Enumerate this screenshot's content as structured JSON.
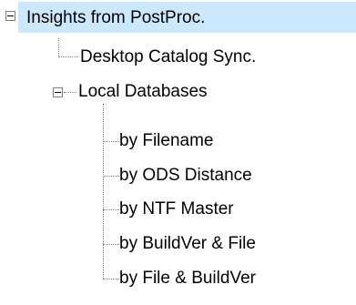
{
  "tree": {
    "root": {
      "label": "Insights from PostProc.",
      "expanded": true,
      "selected": true
    },
    "nodes": [
      {
        "label": "Desktop Catalog Sync."
      },
      {
        "label": "Local Databases",
        "expanded": true,
        "children": [
          {
            "label": "by Filename"
          },
          {
            "label": "by ODS Distance"
          },
          {
            "label": "by NTF Master"
          },
          {
            "label": "by BuildVer & File"
          },
          {
            "label": "by File & BuildVer"
          }
        ]
      }
    ]
  },
  "colors": {
    "selection_background": "#cce8ff",
    "connector_lines": "#808080",
    "text": "#000000"
  },
  "icons": {
    "expander": "minus-box-icon"
  }
}
